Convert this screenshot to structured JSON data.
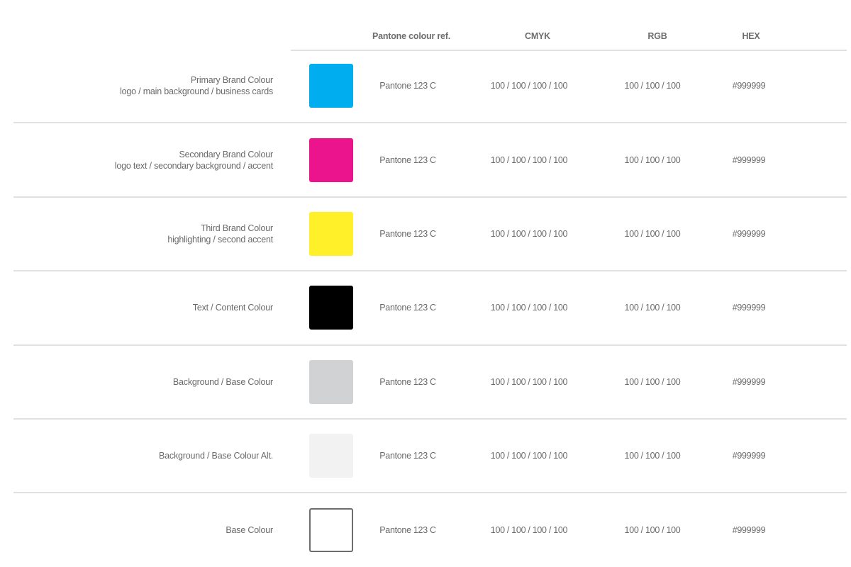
{
  "headers": {
    "pantone": "Pantone colour ref.",
    "cmyk": "CMYK",
    "rgb": "RGB",
    "hex": "HEX"
  },
  "rows": [
    {
      "title": "Primary Brand Colour",
      "usage": "logo / main background / business cards",
      "swatch": "#00aeef",
      "swatch_border": "",
      "pantone": "Pantone 123 C",
      "cmyk": "100 / 100 / 100 / 100",
      "rgb": "100 / 100 / 100",
      "hex": "#999999"
    },
    {
      "title": "Secondary Brand Colour",
      "usage": "logo text / secondary background / accent",
      "swatch": "#ec148c",
      "swatch_border": "",
      "pantone": "Pantone 123 C",
      "cmyk": "100 / 100 / 100 / 100",
      "rgb": "100 / 100 / 100",
      "hex": "#999999"
    },
    {
      "title": "Third Brand Colour",
      "usage": "highlighting / second accent",
      "swatch": "#fff02a",
      "swatch_border": "",
      "pantone": "Pantone 123 C",
      "cmyk": "100 / 100 / 100 / 100",
      "rgb": "100 / 100 / 100",
      "hex": "#999999"
    },
    {
      "title": "Text / Content Colour",
      "usage": "",
      "swatch": "#000000",
      "swatch_border": "",
      "pantone": "Pantone 123 C",
      "cmyk": "100 / 100 / 100 / 100",
      "rgb": "100 / 100 / 100",
      "hex": "#999999"
    },
    {
      "title": "Background / Base Colour",
      "usage": "",
      "swatch": "#d1d2d4",
      "swatch_border": "",
      "pantone": "Pantone 123 C",
      "cmyk": "100 / 100 / 100 / 100",
      "rgb": "100 / 100 / 100",
      "hex": "#999999"
    },
    {
      "title": "Background / Base Colour Alt.",
      "usage": "",
      "swatch": "#f2f2f2",
      "swatch_border": "",
      "pantone": "Pantone 123 C",
      "cmyk": "100 / 100 / 100 / 100",
      "rgb": "100 / 100 / 100",
      "hex": "#999999"
    },
    {
      "title": "Base Colour",
      "usage": "",
      "swatch": "#ffffff",
      "swatch_border": "#6d6d6d",
      "pantone": "Pantone 123 C",
      "cmyk": "100 / 100 / 100 / 100",
      "rgb": "100 / 100 / 100",
      "hex": "#999999"
    }
  ]
}
